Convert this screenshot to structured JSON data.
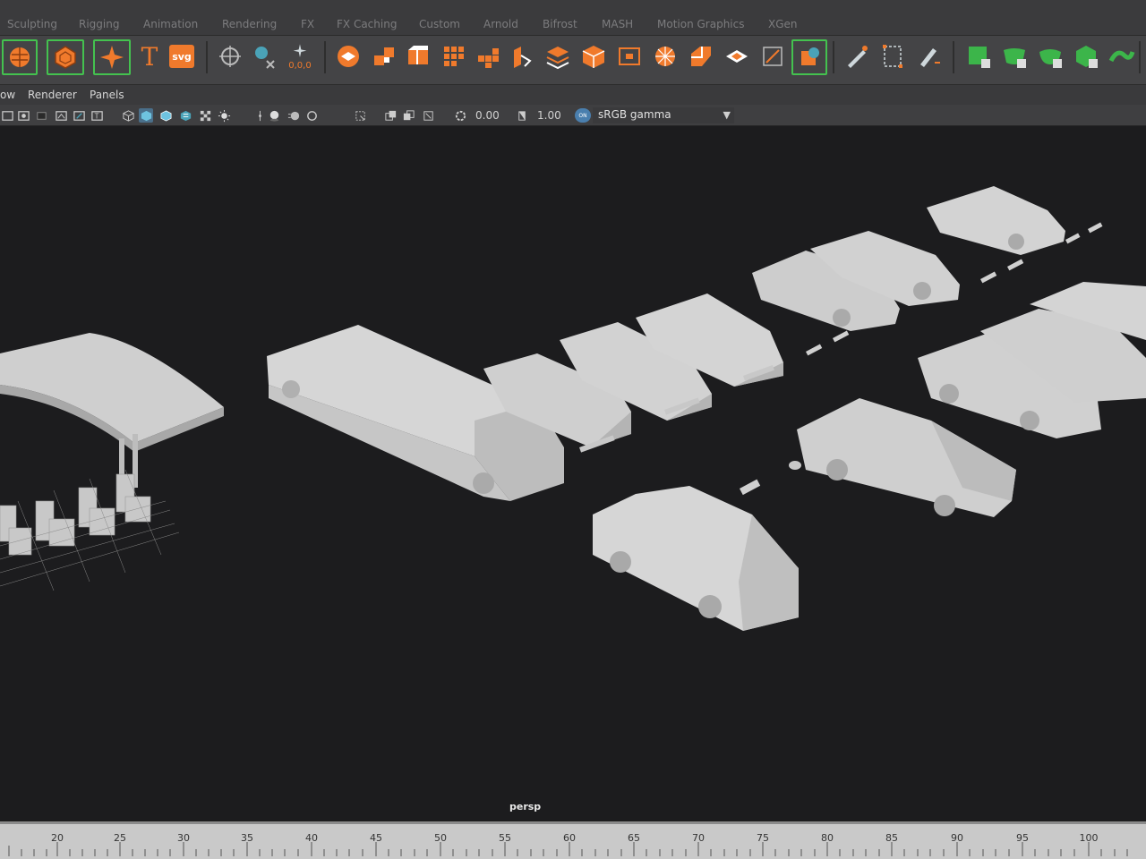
{
  "shelf_tabs": [
    "Sculpting",
    "Rigging",
    "Animation",
    "Rendering",
    "FX",
    "FX Caching",
    "Custom",
    "Arnold",
    "Bifrost",
    "MASH",
    "Motion Graphics",
    "XGen"
  ],
  "shelf": {
    "icons": [
      "sphere-icon",
      "polygon-sphere-icon",
      "star-icon",
      "text-type-icon",
      "svg-icon",
      "compass-icon",
      "transform-icon",
      "sparkle-icon",
      "layer-icon",
      "cubes-icon",
      "bevel-icon",
      "grid-cube-icon",
      "blocks-icon",
      "extrude-icon",
      "stack-icon",
      "box-icon",
      "frame-icon",
      "wheel-icon",
      "split-icon",
      "flat-icon",
      "bounding-box-icon",
      "paint-cube-icon",
      "pen-icon",
      "resize-icon",
      "pencil-icon",
      "green-square-icon",
      "green-bowl-icon",
      "green-cup-icon",
      "green-cube-icon",
      "green-twist-icon"
    ],
    "coord_text": "0,0,0",
    "svg_text": "svg",
    "type_text": "T"
  },
  "panel_menu": [
    "ow",
    "Renderer",
    "Panels"
  ],
  "panel_toolbar": {
    "exposure": "0.00",
    "gamma": "1.00",
    "color_management_badge": "ON",
    "color_space": "sRGB gamma"
  },
  "viewport": {
    "camera_label": "persp"
  },
  "timeslider": {
    "frames": [
      "20",
      "25",
      "30",
      "35",
      "40",
      "45",
      "50",
      "55",
      "60",
      "65",
      "70",
      "75",
      "80",
      "85",
      "90",
      "95",
      "100"
    ]
  },
  "colors": {
    "accent_orange": "#f07a2c",
    "accent_green": "#44c24f",
    "viewport_bg": "#1c1c1e",
    "model_gray": "#d8d8d8"
  }
}
